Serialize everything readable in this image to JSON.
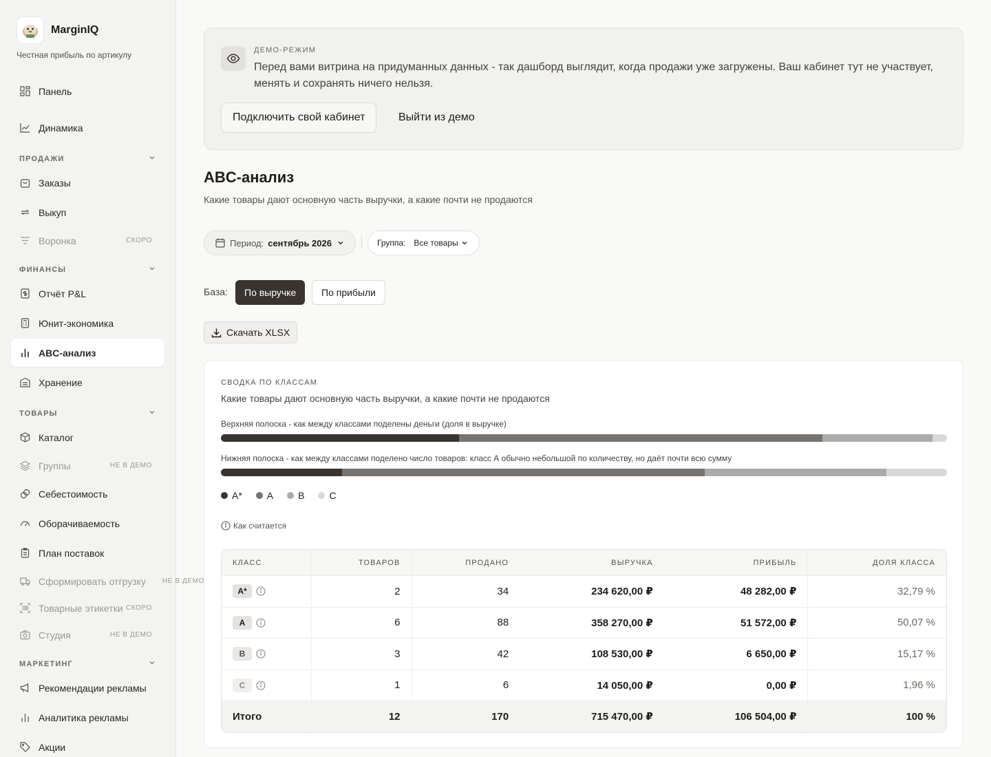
{
  "brand": {
    "name": "MarginIQ",
    "tagline": "Честная прибыль по артикулу"
  },
  "sidebar": {
    "top": [
      {
        "label": "Панель"
      },
      {
        "label": "Динамика"
      }
    ],
    "sections": [
      {
        "title": "ПРОДАЖИ",
        "items": [
          {
            "label": "Заказы"
          },
          {
            "label": "Выкуп"
          },
          {
            "label": "Воронка",
            "tag": "СКОРО"
          }
        ]
      },
      {
        "title": "ФИНАНСЫ",
        "items": [
          {
            "label": "Отчёт P&L"
          },
          {
            "label": "Юнит-экономика"
          },
          {
            "label": "ABC-анализ"
          },
          {
            "label": "Хранение"
          }
        ]
      },
      {
        "title": "ТОВАРЫ",
        "items": [
          {
            "label": "Каталог"
          },
          {
            "label": "Группы",
            "tag": "НЕ В ДЕМО"
          },
          {
            "label": "Себестоимость"
          },
          {
            "label": "Оборачиваемость"
          },
          {
            "label": "План поставок"
          },
          {
            "label": "Сформировать отгрузку",
            "tag": "НЕ В ДЕМО"
          },
          {
            "label": "Товарные этикетки",
            "tag": "СКОРО"
          },
          {
            "label": "Студия",
            "tag": "НЕ В ДЕМО"
          }
        ]
      },
      {
        "title": "МАРКЕТИНГ",
        "items": [
          {
            "label": "Рекомендации рекламы"
          },
          {
            "label": "Аналитика рекламы"
          },
          {
            "label": "Акции"
          }
        ]
      }
    ]
  },
  "demo": {
    "label": "ДЕМО-РЕЖИМ",
    "text": "Перед вами витрина на придуманных данных - так дашборд выглядит, когда продажи уже загружены. Ваш кабинет тут не участвует, менять и сохранять ничего нельзя.",
    "connect_button": "Подключить свой кабинет",
    "exit_button": "Выйти из демо"
  },
  "page": {
    "title": "ABC-анализ",
    "subtitle": "Какие товары дают основную часть выручки, а какие почти не продаются"
  },
  "filters": {
    "period_label": "Период:",
    "period_value": "сентябрь 2026",
    "group_label": "Группа:",
    "group_value": "Все товары"
  },
  "base": {
    "label": "База:",
    "by_revenue": "По выручке",
    "by_profit": "По прибыли"
  },
  "download_button": "Скачать XLSX",
  "summary": {
    "label": "СВОДКА ПО КЛАССАМ",
    "subtitle": "Какие товары дают основную часть выручки, а какие почти не продаются",
    "top_bar_caption": "Верхняя полоска - как между классами поделены деньги (доля в выручке)",
    "bottom_bar_caption": "Нижняя полоска - как между классами поделено число товаров: класс А обычно небольшой по количеству, но даёт почти всю сумму",
    "revenue_share_pct": [
      32.79,
      50.07,
      15.17,
      1.96
    ],
    "count_share_pct": [
      16.67,
      50.0,
      25.0,
      8.33
    ],
    "class_colors": [
      "#3a3431",
      "#767371",
      "#ababa9",
      "#d9d8d6"
    ],
    "legend": [
      "A*",
      "A",
      "B",
      "C"
    ],
    "how_label": "Как считается"
  },
  "table": {
    "headers": [
      "КЛАСС",
      "ТОВАРОВ",
      "ПРОДАНО",
      "ВЫРУЧКА",
      "ПРИБЫЛЬ",
      "ДОЛЯ КЛАССА"
    ],
    "rows": [
      {
        "cls": "A*",
        "items": "2",
        "sold": "34",
        "revenue": "234 620,00 ₽",
        "profit": "48 282,00 ₽",
        "share": "32,79 %"
      },
      {
        "cls": "A",
        "items": "6",
        "sold": "88",
        "revenue": "358 270,00 ₽",
        "profit": "51 572,00 ₽",
        "share": "50,07 %"
      },
      {
        "cls": "B",
        "items": "3",
        "sold": "42",
        "revenue": "108 530,00 ₽",
        "profit": "6 650,00 ₽",
        "share": "15,17 %"
      },
      {
        "cls": "C",
        "items": "1",
        "sold": "6",
        "revenue": "14 050,00 ₽",
        "profit": "0,00 ₽",
        "share": "1,96 %"
      }
    ],
    "total": {
      "label": "Итого",
      "items": "12",
      "sold": "170",
      "revenue": "715 470,00 ₽",
      "profit": "106 504,00 ₽",
      "share": "100 %"
    }
  }
}
